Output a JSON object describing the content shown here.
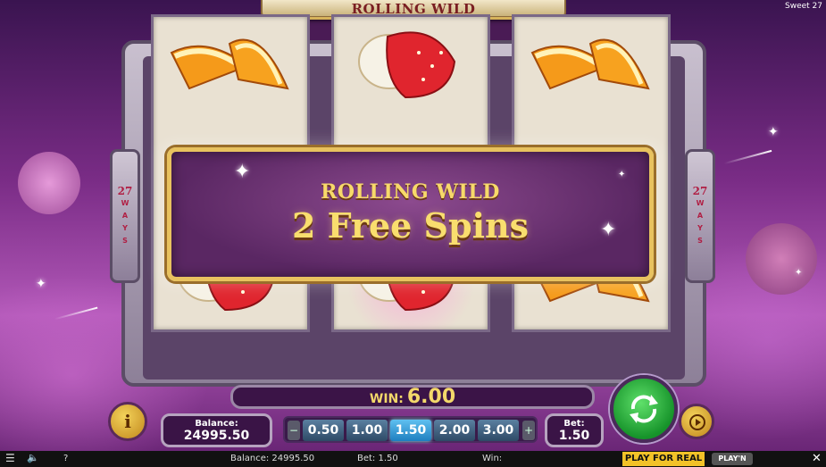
{
  "header": {
    "title": "ROLLING WILD",
    "game_name": "Sweet 27"
  },
  "side_plates": {
    "ways_number": "27",
    "ways_letters": "W A Y S"
  },
  "banner": {
    "subtitle": "ROLLING WILD",
    "main_text": "2 Free Spins"
  },
  "reels": {
    "top_row": [
      "orange-slice",
      "strawberry-cream",
      "orange-slice"
    ],
    "bottom_row": [
      "strawberry-cream",
      "strawberry-cream",
      "orange-slice"
    ]
  },
  "win": {
    "label": "WIN:",
    "value": "6.00"
  },
  "balance": {
    "label": "Balance:",
    "value": "24995.50"
  },
  "bet_selector": {
    "minus": "−",
    "plus": "+",
    "options": [
      "0.50",
      "1.00",
      "1.50",
      "2.00",
      "3.00"
    ],
    "selected": "1.50"
  },
  "bet": {
    "label": "Bet:",
    "value": "1.50"
  },
  "info_button": {
    "label": "i"
  },
  "bottom_bar": {
    "menu": "☰",
    "sound": "🔈",
    "help": "?",
    "balance_text": "Balance: 24995.50",
    "bet_text": "Bet: 1.50",
    "win_text": "Win:",
    "play_for_real": "PLAY FOR REAL",
    "brand": "PLAY'N GO",
    "close": "✕"
  },
  "colors": {
    "banner_gold": "#e8c25f",
    "banner_purple": "#5a2763",
    "spin_green": "#16932a",
    "win_text": "#f3d86a"
  }
}
